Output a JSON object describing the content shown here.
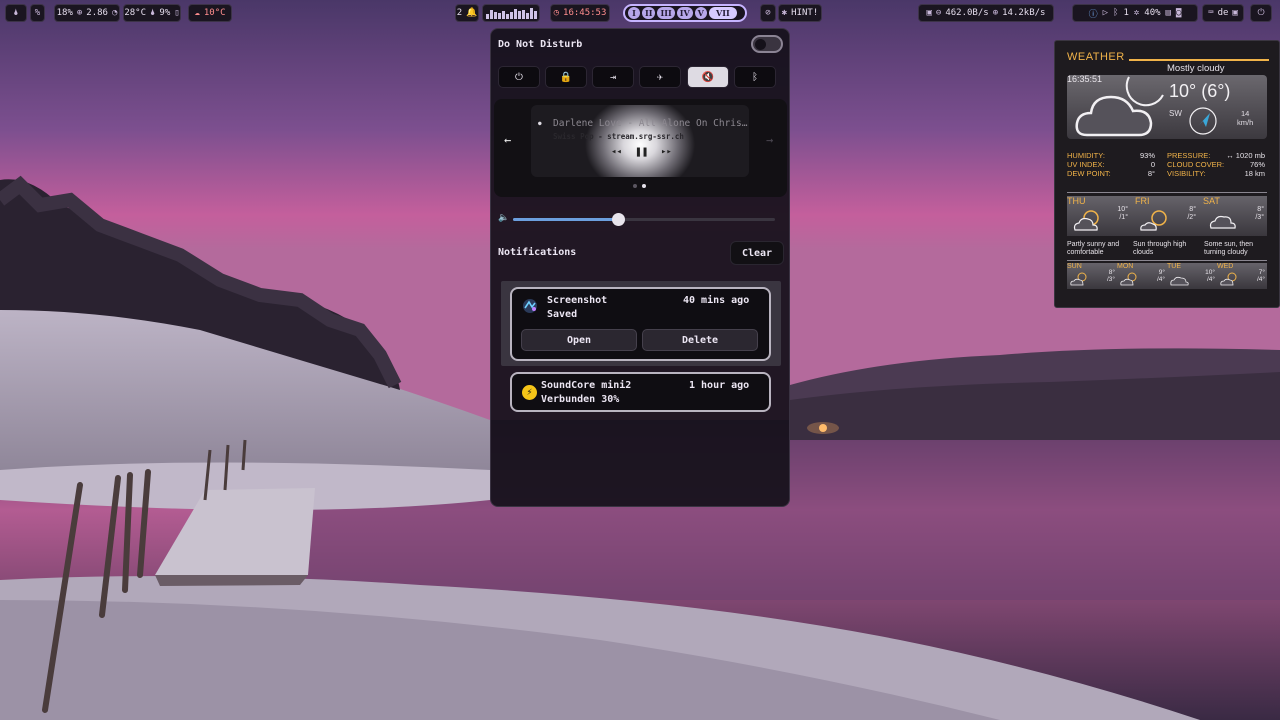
{
  "topbar": {
    "left": {
      "mem_pct": "18%",
      "load": "2.86",
      "cpu_temp": "28°C",
      "humidity_pct": "9%",
      "outside_temp": "10°C"
    },
    "center": {
      "notif_count": "2",
      "time": "16:45:53",
      "workspaces": [
        "I",
        "II",
        "III",
        "IV",
        "V",
        "VII"
      ],
      "active_workspace": "VII",
      "hint_label": "HINT!"
    },
    "right": {
      "net_down": "462.0B/s",
      "net_up": "14.2kB/s",
      "bluetooth_count": "1",
      "battery_pct": "40%",
      "keyboard_layout": "de"
    }
  },
  "panel": {
    "dnd_label": "Do Not Disturb",
    "dnd_enabled": false,
    "quick_settings": [
      {
        "name": "power",
        "active": false
      },
      {
        "name": "lock",
        "active": false
      },
      {
        "name": "logout",
        "active": false
      },
      {
        "name": "airplane",
        "active": false
      },
      {
        "name": "mute",
        "active": true
      },
      {
        "name": "bluetooth",
        "active": false
      }
    ],
    "media": {
      "title": "Darlene Love - All Alone On Christmas",
      "subtitle": "Swiss Pop - stream.srg-ssr.ch",
      "state": "playing",
      "page": 2,
      "pages": 2
    },
    "volume": 0.4,
    "notifications_label": "Notifications",
    "clear_label": "Clear",
    "notifications": [
      {
        "app": "Screenshot",
        "time": "40 mins ago",
        "body": "Saved",
        "actions": [
          "Open",
          "Delete"
        ]
      },
      {
        "app": "SoundCore mini2",
        "time": "1 hour ago",
        "body": "Verbunden 30%"
      }
    ]
  },
  "weather": {
    "title": "WEATHER",
    "condition": "Mostly cloudy",
    "clock": "16:35:51",
    "temp": "10° (6°)",
    "wind_dir": "SW",
    "wind_speed": "14",
    "wind_unit": "km/h",
    "stats_left": [
      {
        "label": "HUMIDITY:",
        "value": "93%"
      },
      {
        "label": "UV INDEX:",
        "value": "0"
      },
      {
        "label": "DEW POINT:",
        "value": "8°"
      }
    ],
    "stats_right": [
      {
        "label": "PRESSURE:",
        "value": "↔ 1020 mb"
      },
      {
        "label": "CLOUD COVER:",
        "value": "76%"
      },
      {
        "label": "VISIBILITY:",
        "value": "18 km"
      }
    ],
    "forecast": [
      {
        "day": "THU",
        "high": "10°",
        "low": "/1°",
        "desc": "Partly sunny and comfortable"
      },
      {
        "day": "FRI",
        "high": "8°",
        "low": "/2°",
        "desc": "Sun through high clouds"
      },
      {
        "day": "SAT",
        "high": "8°",
        "low": "/3°",
        "desc": "Some sun, then turning cloudy"
      }
    ],
    "forecast_small": [
      {
        "day": "SUN",
        "high": "8°",
        "low": "/3°"
      },
      {
        "day": "MON",
        "high": "9°",
        "low": "/4°"
      },
      {
        "day": "TUE",
        "high": "10°",
        "low": "/4°"
      },
      {
        "day": "WED",
        "high": "7°",
        "low": "/4°"
      }
    ]
  }
}
